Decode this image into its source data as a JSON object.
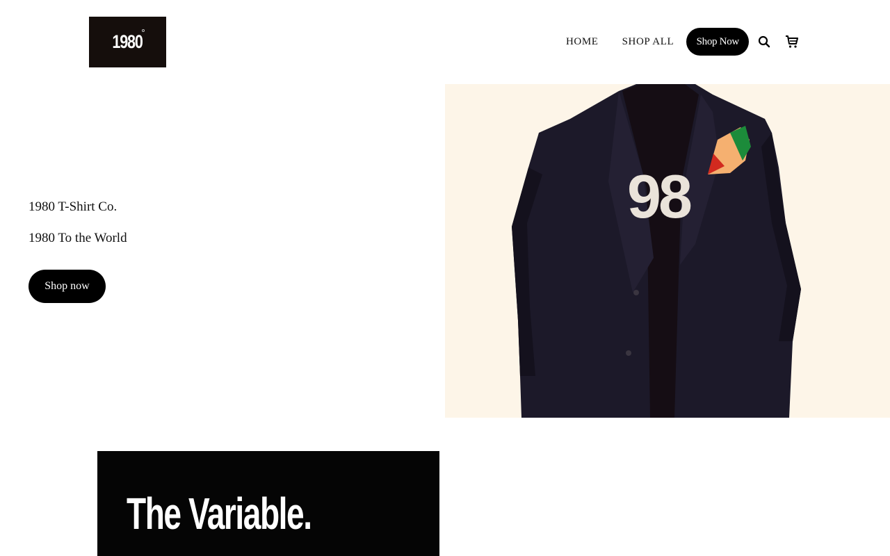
{
  "header": {
    "logo_text": "1980",
    "nav": {
      "home_label": "HOME",
      "shop_all_label": "SHOP ALL",
      "cta_label": "Shop Now"
    },
    "icons": [
      "search-icon",
      "cart-icon"
    ]
  },
  "hero": {
    "title": "1980 T-Shirt Co.",
    "subtitle": "1980 To the World",
    "cta_label": "Shop now",
    "image_text": "98"
  },
  "promo": {
    "title": "The Variable."
  },
  "colors": {
    "accent": "#000000",
    "hero_bg": "#fdf5e8",
    "logo_bg": "#150e0c"
  }
}
